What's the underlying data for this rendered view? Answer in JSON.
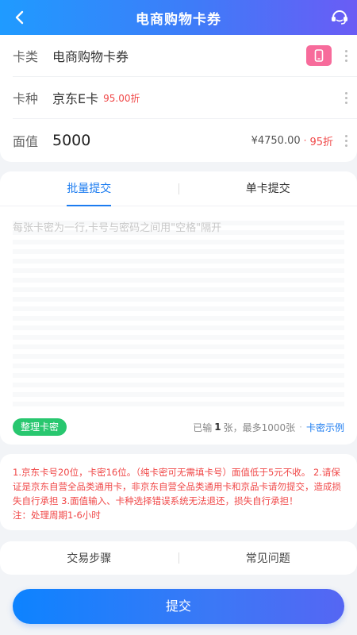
{
  "header": {
    "title": "电商购物卡券",
    "back_icon": "back-arrow-icon",
    "service_icon": "customer-service-icon"
  },
  "card_info": {
    "category_label": "卡类",
    "category_value": "电商购物卡券",
    "type_label": "卡种",
    "type_value": "京东E卡",
    "type_discount": "95.00折",
    "face_label": "面值",
    "face_value": "5000",
    "price": "¥4750.00",
    "price_sep": "·",
    "price_discount": "95折"
  },
  "submit_panel": {
    "tabs": [
      {
        "label": "批量提交",
        "active": true
      },
      {
        "label": "单卡提交",
        "active": false
      }
    ],
    "placeholder": "每张卡密为一行,卡号与密码之间用\"空格\"隔开",
    "tidy_button": "整理卡密",
    "count_prefix": "已输",
    "count_value": "1",
    "count_suffix": "张，最多1000张",
    "dot_sep": "·",
    "example_link": "卡密示例"
  },
  "notice": {
    "text": "1.京东卡号20位，卡密16位。（纯卡密可无需填卡号）面值低于5元不收。 2.请保证是京东自营全品类通用卡，非京东自营全品类通用卡和京品卡请勿提交，造成损失自行承担 3.面值输入、卡种选择错误系统无法退还，损失自行承担！",
    "note": "注：处理周期1-6小时"
  },
  "help_bar": {
    "steps": "交易步骤",
    "faq": "常见问题"
  },
  "submit_button": "提交",
  "colors": {
    "accent": "#1c7cf0",
    "warning": "#f04848",
    "green": "#28c76f",
    "pink": "#f76b9b"
  }
}
